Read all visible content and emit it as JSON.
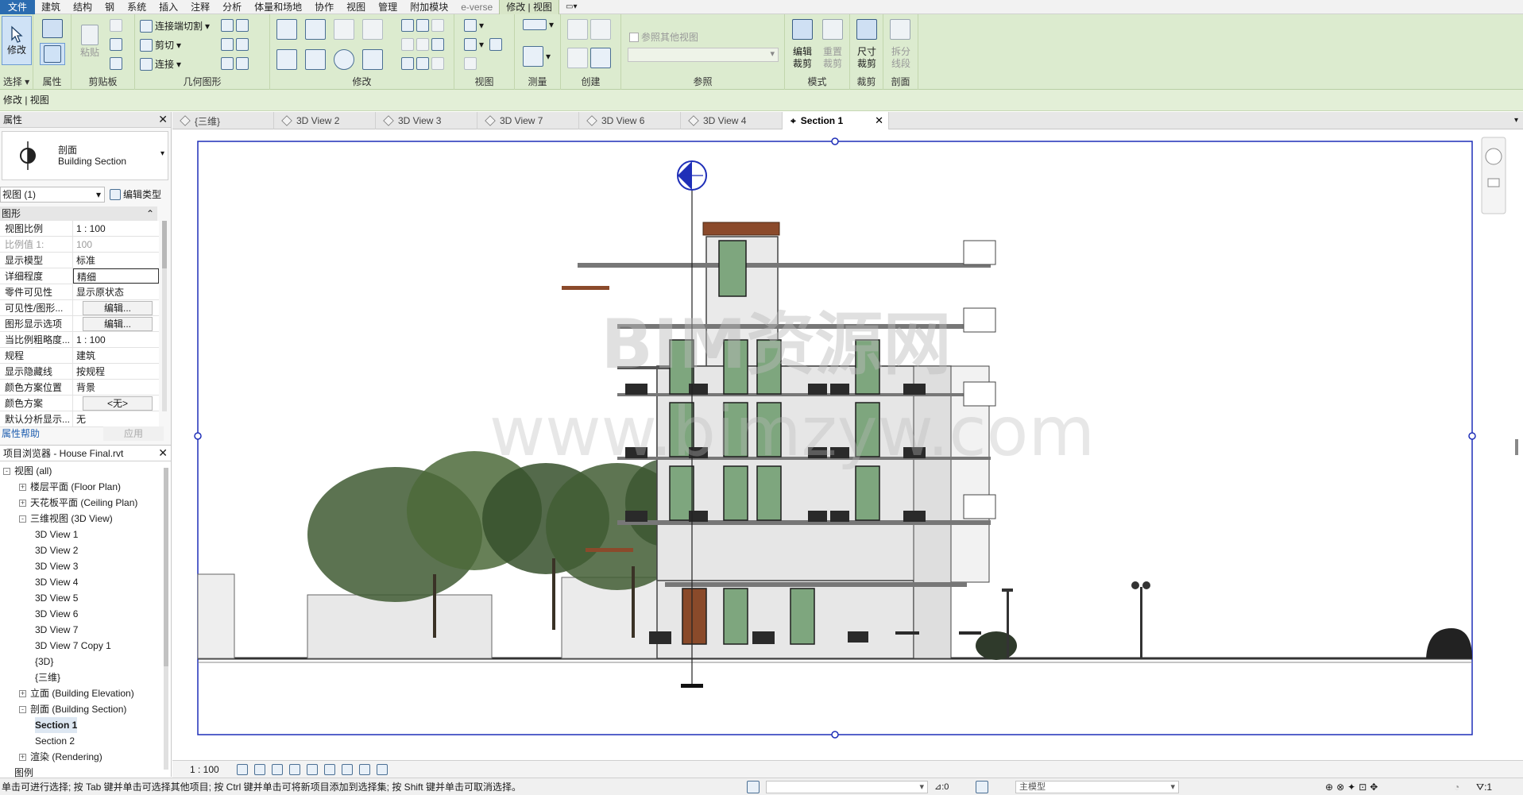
{
  "menu": {
    "tabs": [
      "文件",
      "建筑",
      "结构",
      "钢",
      "系统",
      "插入",
      "注释",
      "分析",
      "体量和场地",
      "协作",
      "视图",
      "管理",
      "附加模块",
      "e-verse",
      "修改 | 视图"
    ]
  },
  "ribbon": {
    "modify_label": "修改",
    "panels": {
      "select": "选择",
      "properties": "属性",
      "clipboard": "剪贴板",
      "geometry": "几何图形",
      "modify": "修改",
      "view": "视图",
      "measure": "测量",
      "create": "创建",
      "reference": "参照",
      "mode": "模式",
      "crop": "裁剪",
      "section": "剖面"
    },
    "paste_label": "粘贴",
    "geometry_items": [
      "连接端切割",
      "剪切",
      "连接"
    ],
    "ref_other_view": "参照其他视图",
    "mode_buttons": [
      "编辑\n裁剪",
      "重置\n裁剪"
    ],
    "crop_button": "尺寸\n裁剪",
    "section_button": "拆分\n线段"
  },
  "options_bar": "修改 | 视图",
  "properties": {
    "title": "属性",
    "type_name": "剖面",
    "type_sub": "Building Section",
    "selector": "视图 (1)",
    "edit_type": "编辑类型",
    "group": "图形",
    "rows": [
      {
        "k": "视图比例",
        "v": "1 : 100"
      },
      {
        "k": "比例值 1:",
        "v": "100"
      },
      {
        "k": "显示模型",
        "v": "标准"
      },
      {
        "k": "详细程度",
        "v": "精细"
      },
      {
        "k": "零件可见性",
        "v": "显示原状态"
      },
      {
        "k": "可见性/图形...",
        "v": "编辑..."
      },
      {
        "k": "图形显示选项",
        "v": "编辑..."
      },
      {
        "k": "当比例粗略度...",
        "v": "1 : 100"
      },
      {
        "k": "规程",
        "v": "建筑"
      },
      {
        "k": "显示隐藏线",
        "v": "按规程"
      },
      {
        "k": "颜色方案位置",
        "v": "背景"
      },
      {
        "k": "颜色方案",
        "v": "<无>"
      },
      {
        "k": "默认分析显示...",
        "v": "无"
      }
    ],
    "help": "属性帮助",
    "apply": "应用"
  },
  "browser": {
    "title": "项目浏览器 - House Final.rvt",
    "items": [
      {
        "label": "视图 (all)",
        "level": 0,
        "tog": "-"
      },
      {
        "label": "楼层平面 (Floor Plan)",
        "level": 1,
        "tog": "+"
      },
      {
        "label": "天花板平面 (Ceiling Plan)",
        "level": 1,
        "tog": "+"
      },
      {
        "label": "三维视图 (3D View)",
        "level": 1,
        "tog": "-"
      },
      {
        "label": "3D View 1",
        "level": 2,
        "tog": ""
      },
      {
        "label": "3D View 2",
        "level": 2,
        "tog": ""
      },
      {
        "label": "3D View 3",
        "level": 2,
        "tog": ""
      },
      {
        "label": "3D View 4",
        "level": 2,
        "tog": ""
      },
      {
        "label": "3D View 5",
        "level": 2,
        "tog": ""
      },
      {
        "label": "3D View 6",
        "level": 2,
        "tog": ""
      },
      {
        "label": "3D View 7",
        "level": 2,
        "tog": ""
      },
      {
        "label": "3D View 7 Copy 1",
        "level": 2,
        "tog": ""
      },
      {
        "label": "{3D}",
        "level": 2,
        "tog": ""
      },
      {
        "label": "{三维}",
        "level": 2,
        "tog": ""
      },
      {
        "label": "立面 (Building Elevation)",
        "level": 1,
        "tog": "+"
      },
      {
        "label": "剖面 (Building Section)",
        "level": 1,
        "tog": "-"
      },
      {
        "label": "Section 1",
        "level": 2,
        "tog": "",
        "selected": true
      },
      {
        "label": "Section 2",
        "level": 2,
        "tog": ""
      },
      {
        "label": "渲染 (Rendering)",
        "level": 1,
        "tog": "+"
      },
      {
        "label": "图例",
        "level": 0,
        "tog": ""
      }
    ]
  },
  "view_tabs": [
    "{三维}",
    "3D View 2",
    "3D View 3",
    "3D View 7",
    "3D View 6",
    "3D View 4",
    "Section 1"
  ],
  "watermark": {
    "line1": "BIM资源网",
    "line2": "www.bimzyw.com"
  },
  "view_control": {
    "scale": "1 : 100"
  },
  "status": {
    "message": "单击可进行选择; 按 Tab 键并单击可选择其他项目; 按 Ctrl 键并单击可将新项目添加到选择集; 按 Shift 键并单击可取消选择。",
    "zero": ":0",
    "model": "主模型",
    "filter": ":1"
  },
  "colors": {
    "accent": "#2b6cb0",
    "ribbon": "#dcebcf",
    "crop": "#1f2fb8",
    "window": "#7ea67e"
  }
}
